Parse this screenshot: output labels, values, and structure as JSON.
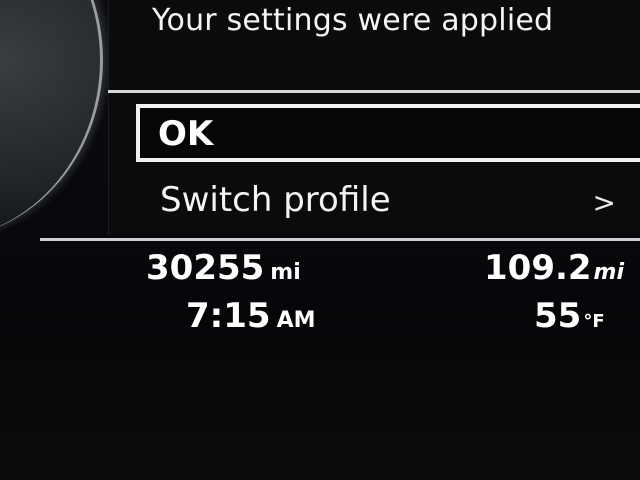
{
  "dialog": {
    "message": "Your settings were applied",
    "ok_label": "OK",
    "switch_label": "Switch profile",
    "chevron": ">"
  },
  "status": {
    "odometer_value": "30255",
    "odometer_unit": "mi",
    "time_value": "7:15",
    "time_period": "AM",
    "range_value": "109.2",
    "range_unit": "mi",
    "temperature_value": "55",
    "temperature_unit": "°F"
  }
}
